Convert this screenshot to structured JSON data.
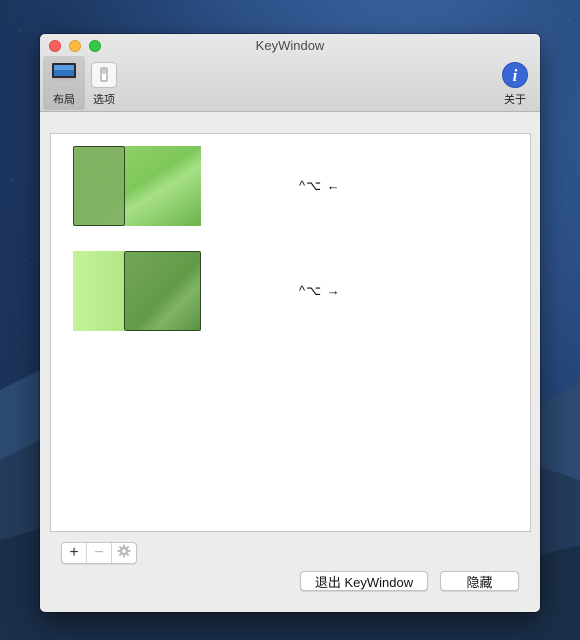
{
  "window": {
    "title": "KeyWindow"
  },
  "toolbar": {
    "layout_label": "布局",
    "options_label": "选项",
    "about_label": "关于",
    "about_icon_glyph": "i"
  },
  "layouts": [
    {
      "active_half": "left",
      "shortcut": "^⌥ ←"
    },
    {
      "active_half": "right",
      "shortcut": "^⌥ →"
    }
  ],
  "controls": {
    "add": "+",
    "remove": "−",
    "settings_icon": "gear-icon"
  },
  "buttons": {
    "quit": "退出 KeyWindow",
    "hide": "隐藏"
  },
  "colors": {
    "accent_green": "#86cf63",
    "selected_green": "#6aa64b",
    "about_icon_blue": "#3a67d6"
  }
}
